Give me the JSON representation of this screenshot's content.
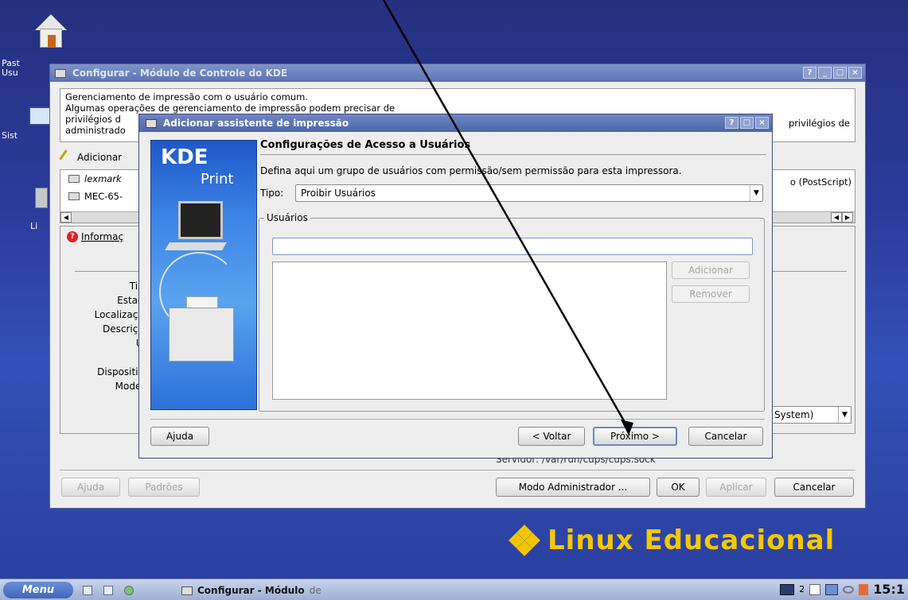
{
  "desktop": {
    "icons": [
      {
        "label": "Past Usu"
      },
      {
        "label": "Sist"
      },
      {
        "label": "Li"
      }
    ]
  },
  "main_window": {
    "title": "Configurar - Módulo de Controle do KDE",
    "description": [
      "Gerenciamento de impressão com o usuário comum.",
      "Algumas operações de gerenciamento de impressão podem precisar de",
      "privilégios d",
      "administrado"
    ],
    "description_right": "privilégios de",
    "toolbar_add_label": "Adicionar",
    "printers": [
      {
        "name": "lexmark"
      },
      {
        "name": "MEC-65-"
      }
    ],
    "printer_right_text": "o (PostScript)",
    "info_tab_label": "Informaç",
    "info_labels": [
      "Tipo",
      "Estado",
      "Localização",
      "Descrição",
      "UR",
      "",
      "Dispositivo",
      "Modelo"
    ],
    "system_combo": "System)",
    "server_text": "Servidor: /var/run/cups/cups.sock",
    "buttons": {
      "help": "Ajuda",
      "defaults": "Padrões",
      "admin_mode": "Modo Administrador ...",
      "ok": "OK",
      "apply": "Aplicar",
      "cancel": "Cancelar"
    }
  },
  "dialog": {
    "title": "Adicionar assistente de impressão",
    "banner_title": "KDE",
    "banner_subtitle": "Print",
    "section_title": "Configurações de Acesso a Usuários",
    "section_description": "Defina aqui um grupo de usuários com permissão/sem permissão para esta impressora.",
    "tipo_label": "Tipo:",
    "tipo_value": "Proibir Usuários",
    "group_label": "Usuários",
    "user_input_value": "",
    "add_button": "Adicionar",
    "remove_button": "Remover",
    "buttons": {
      "help": "Ajuda",
      "back": "< Voltar",
      "next": "Próximo >",
      "cancel": "Cancelar"
    }
  },
  "brand": {
    "text": "Linux Educacional",
    "color": "#f5c800"
  },
  "taskbar": {
    "menu_label": "Menu",
    "task_label": "Configurar - Módulo",
    "task_suffix": "de",
    "desktop_pager": "2",
    "clock": "15:1"
  }
}
